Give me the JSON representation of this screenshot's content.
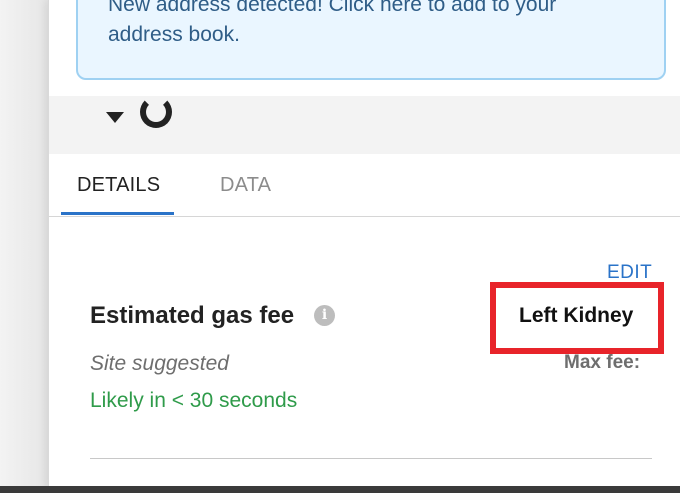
{
  "notice": {
    "line1": "New address detected! Click here to add to your",
    "line2": "address book."
  },
  "tabs": [
    {
      "label": "DETAILS",
      "active": true
    },
    {
      "label": "DATA",
      "active": false
    }
  ],
  "gas": {
    "title": "Estimated gas fee",
    "edit_label": "EDIT",
    "fee_value": "Left Kidney",
    "site_suggested": "Site suggested",
    "max_fee_label": "Max fee:",
    "likely_text": "Likely in < 30 seconds"
  },
  "icons": {
    "info": "info-icon",
    "caret": "caret-down-icon",
    "spinner": "spinner-icon"
  },
  "colors": {
    "accent": "#2a73c8",
    "success": "#2f9b4a",
    "highlight": "#e8242a",
    "notice_bg": "#eaf6ff",
    "notice_border": "#9fd1f2"
  }
}
